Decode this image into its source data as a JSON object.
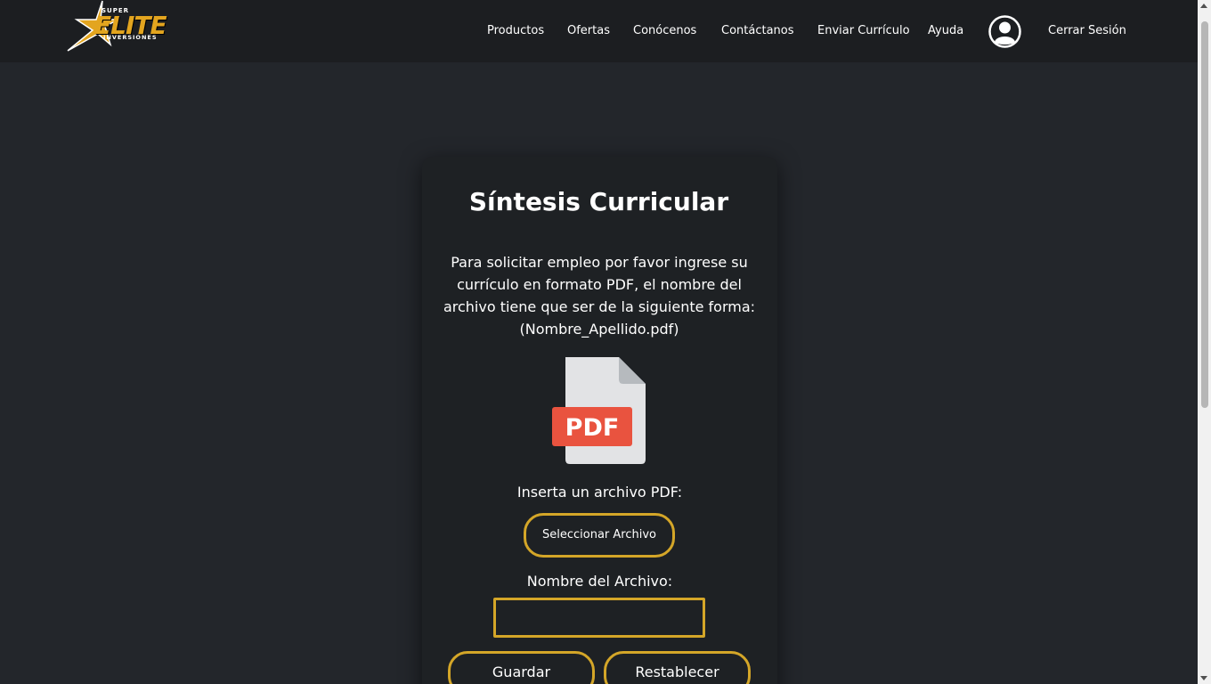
{
  "brand": {
    "super": "SUPER",
    "elite": "ELITE",
    "inversiones": "INVERSIONES"
  },
  "nav": {
    "productos": "Productos",
    "ofertas": "Ofertas",
    "conocenos": "Conócenos",
    "contactanos": "Contáctanos",
    "enviar_curriculo": "Enviar Currículo",
    "ayuda": "Ayuda",
    "cerrar_sesion": "Cerrar Sesión"
  },
  "main": {
    "title": "Síntesis Curricular",
    "description": "Para solicitar empleo por favor ingrese su currículo en formato PDF, el nombre del archivo tiene que ser de la siguiente forma: (Nombre_Apellido.pdf)",
    "pdf_label": "PDF",
    "insert_label": "Inserta un archivo PDF:",
    "select_button": "Seleccionar Archivo",
    "filename_label": "Nombre del Archivo:",
    "filename_value": "",
    "save_button": "Guardar",
    "reset_button": "Restablecer"
  },
  "colors": {
    "accent": "#d4a628",
    "pdf_red": "#e9533f",
    "background": "#23262b",
    "navbar": "#1c1e21"
  }
}
